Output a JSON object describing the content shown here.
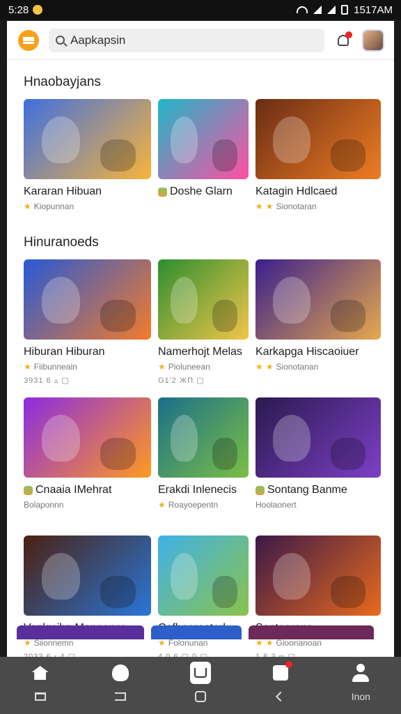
{
  "status_bar": {
    "time": "5:28",
    "right_text": "1517AM"
  },
  "header": {
    "search": {
      "value": "Aapkapsin"
    }
  },
  "sections": [
    {
      "title": "Hnaobayjans"
    },
    {
      "title": "Hinuranoeds"
    }
  ],
  "rows": [
    [
      {
        "title": "Kararan Hibuan",
        "subtitle": "Kiopunnan",
        "rating_stars": 1,
        "meta": "",
        "colors": [
          "#3f6fe0",
          "#f8b43a"
        ]
      },
      {
        "title": "Doshe Glarn",
        "subtitle": "",
        "title_icon": true,
        "rating_stars": 0,
        "meta": "",
        "colors": [
          "#1fb7c8",
          "#ff4fa2"
        ]
      },
      {
        "title": "Katagin Hdlcaed",
        "subtitle": "Sionotaran",
        "rating_stars": 2,
        "meta": "",
        "colors": [
          "#6a2c14",
          "#ef7d24"
        ]
      }
    ],
    [
      {
        "title": "Hiburan Hiburan",
        "subtitle": "Fiibunneain",
        "rating_stars": 1,
        "meta": "3931 6 ▵ ▢",
        "colors": [
          "#2759d6",
          "#f37b2a"
        ]
      },
      {
        "title": "Namerhojt Melas",
        "subtitle": "Pioluneean",
        "rating_stars": 1,
        "meta": "G1'2 ЖΠ ▢",
        "colors": [
          "#2d8e2f",
          "#f2c64a"
        ]
      },
      {
        "title": "Karkapga Hiscaoiuer",
        "subtitle": "Sionotanan",
        "rating_stars": 2,
        "meta": "",
        "colors": [
          "#3a1f8d",
          "#e7a84d"
        ]
      }
    ],
    [
      {
        "title": "Cnaaia IMehrat",
        "subtitle": "Bolaponnn",
        "title_icon": true,
        "rating_stars": 0,
        "meta": "",
        "colors": [
          "#8b2ce0",
          "#ff9a1f"
        ]
      },
      {
        "title": "Erakdi Inlenecis",
        "subtitle": "Roayoepentn",
        "rating_stars": 1,
        "meta": "",
        "colors": [
          "#1a6f8a",
          "#7bbf45"
        ]
      },
      {
        "title": "Sontang Banme",
        "subtitle": "Hoolaonert",
        "title_icon": true,
        "rating_stars": 0,
        "meta": "",
        "colors": [
          "#2a1a4e",
          "#7d3fc7"
        ]
      }
    ],
    [
      {
        "title": "Vaplgcibn Mannener",
        "subtitle": "Siionnemn",
        "rating_stars": 1,
        "meta": "2033 6 ‹ 4 ▢",
        "colors": [
          "#4b2110",
          "#2a76d8"
        ]
      },
      {
        "title": "Cafhaoreaterl",
        "subtitle": "Folonunan",
        "rating_stars": 1,
        "meta": "4.0.6 ▢ 0 ▢",
        "colors": [
          "#3fb1e8",
          "#8bc34a"
        ]
      },
      {
        "title": "Santearans",
        "subtitle": "Gioonanoan",
        "rating_stars": 2,
        "meta": "1 8.3 ∞ ▢",
        "colors": [
          "#3b1847",
          "#e86a1d"
        ]
      }
    ]
  ],
  "peek_colors": [
    "#5a2f9b",
    "#2e5ec9",
    "#6b2a5a"
  ],
  "bottom_nav": {
    "items": [
      "home",
      "games",
      "store",
      "puzzle",
      "profile"
    ],
    "system_label": "Inon"
  }
}
